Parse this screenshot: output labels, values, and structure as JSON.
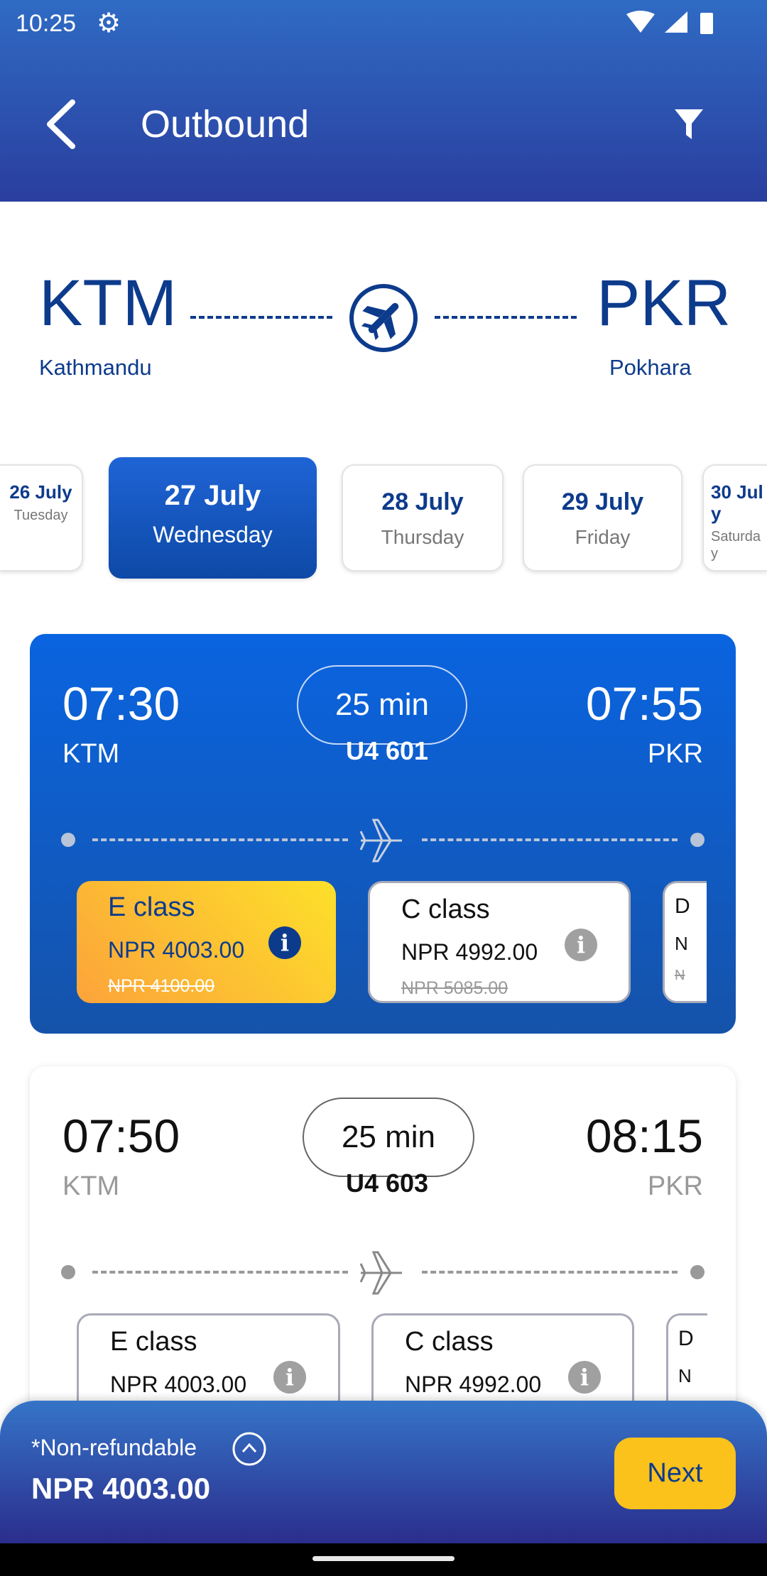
{
  "status_bar": {
    "time": "10:25",
    "icons": [
      "gear-icon",
      "wifi-icon",
      "signal-icon",
      "battery-icon"
    ]
  },
  "header": {
    "title": "Outbound",
    "back_icon": "arrow-left-icon",
    "filter_icon": "filter-icon"
  },
  "route": {
    "from_code": "KTM",
    "from_city": "Kathmandu",
    "to_code": "PKR",
    "to_city": "Pokhara"
  },
  "dates": [
    {
      "date": "26 July",
      "day": "Tuesday"
    },
    {
      "date": "27 July",
      "day": "Wednesday",
      "selected": true
    },
    {
      "date": "28 July",
      "day": "Thursday"
    },
    {
      "date": "29 July",
      "day": "Friday"
    },
    {
      "date": "30 July",
      "day": "Saturday"
    }
  ],
  "flights": [
    {
      "depart": "07:30",
      "arrive": "07:55",
      "duration": "25 min",
      "from": "KTM",
      "to": "PKR",
      "flight_no": "U4 601",
      "fares": [
        {
          "class": "E class",
          "price": "NPR 4003.00",
          "original": "NPR 4100.00"
        },
        {
          "class": "C class",
          "price": "NPR 4992.00",
          "original": "NPR 5085.00"
        },
        {
          "class": "D",
          "price": "N",
          "original": "N"
        }
      ]
    },
    {
      "depart": "07:50",
      "arrive": "08:15",
      "duration": "25 min",
      "from": "KTM",
      "to": "PKR",
      "flight_no": "U4 603",
      "fares": [
        {
          "class": "E class",
          "price": "NPR 4003.00"
        },
        {
          "class": "C class",
          "price": "NPR 4992.00"
        },
        {
          "class": "D",
          "price": "N"
        }
      ]
    }
  ],
  "footer": {
    "note": "*Non-refundable",
    "total": "NPR 4003.00",
    "next_label": "Next"
  },
  "colors": {
    "primary": "#0d3b8c",
    "accent": "#fbc21b",
    "card_selected": "#0a5fd6"
  }
}
